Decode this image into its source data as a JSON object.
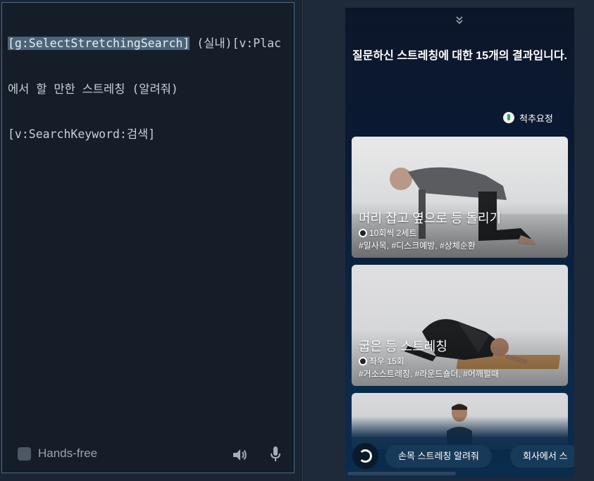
{
  "editor": {
    "lines": [
      {
        "pre": "",
        "highlight": "[g:SelectStretchingSearch]",
        "post": " (실내)[v:Plac"
      },
      {
        "pre": "에서 할 만한 스트레칭 (알려줘)",
        "highlight": "",
        "post": ""
      },
      {
        "pre": "[v:SearchKeyword:검색]",
        "highlight": "",
        "post": ""
      }
    ]
  },
  "bottom_bar": {
    "hands_free_label": "Hands-free",
    "speaker_icon": "speaker-icon",
    "mic_icon": "mic-icon"
  },
  "result": {
    "title": "질문하신 스트레칭에 대한 15개의 결과입니다.",
    "tag_chip": "척추요정"
  },
  "cards": [
    {
      "title": "머리 잡고 옆으로 등 돌리기",
      "meta": "10회씩 2세트",
      "tags": "#일사목, #디스크예방, #상체순환"
    },
    {
      "title": "굽은 등 스트레칭",
      "meta": "좌우 15회",
      "tags": "#거소스트레칭, #라운드숄더, #어깨펄때"
    },
    {
      "title": "",
      "meta": "",
      "tags": ""
    }
  ],
  "suggestions": [
    "손목 스트레칭 알려줘",
    "회사에서 스"
  ],
  "colors": {
    "editor_bg": "#151d29",
    "highlight": "#4b6577",
    "phone_bg_top": "#0d1629",
    "phone_bg_bottom": "#0c2f52",
    "chip_bg": "#183a59"
  }
}
